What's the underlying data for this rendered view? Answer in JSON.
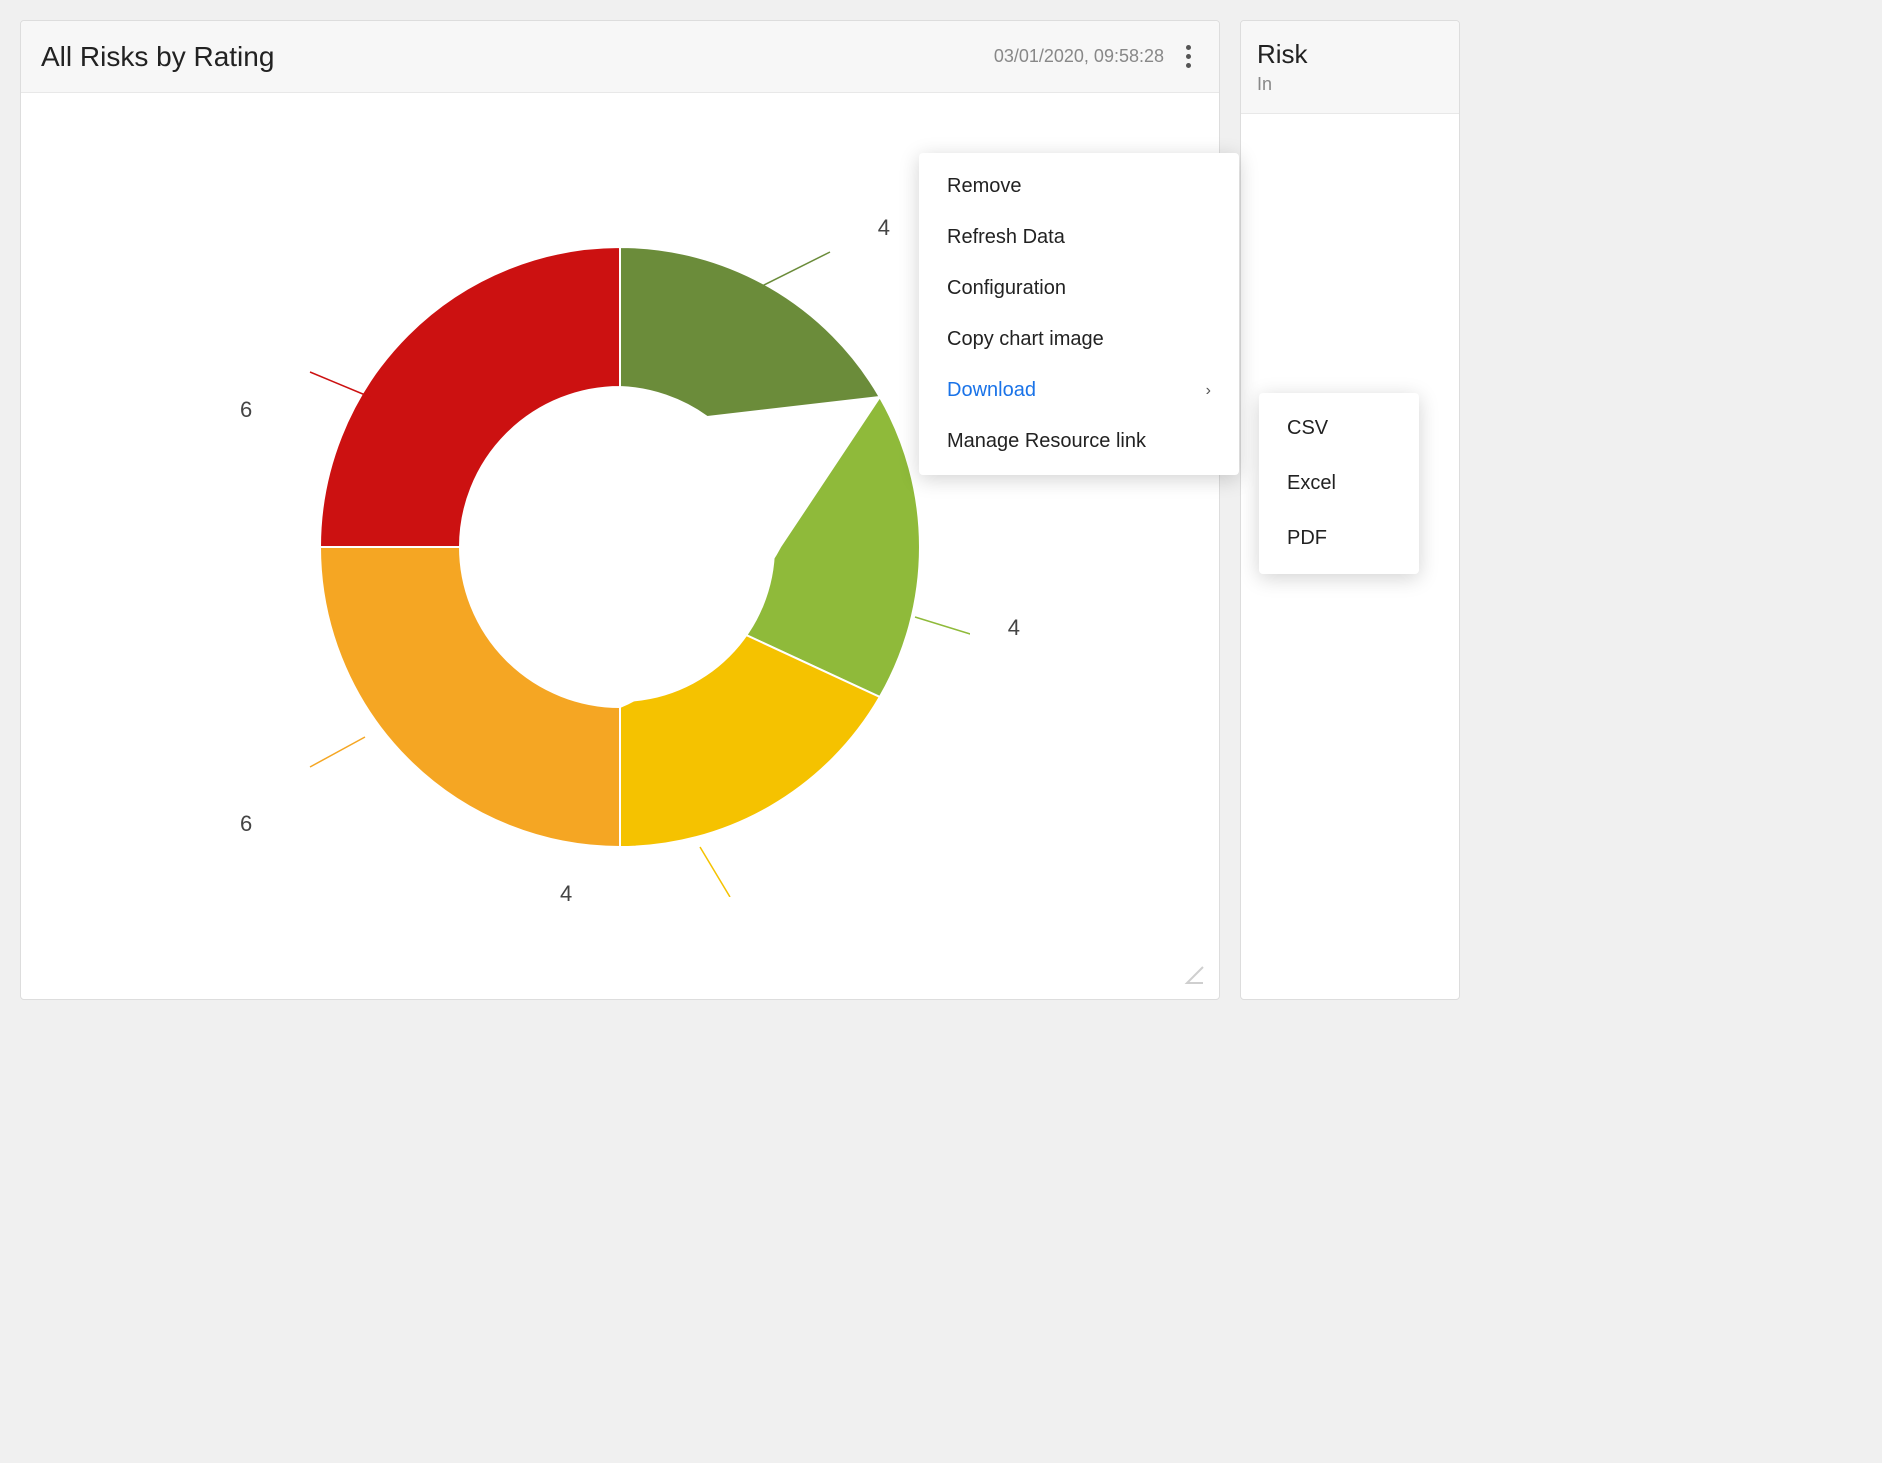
{
  "panel": {
    "title": "All Risks by Rating",
    "timestamp": "03/01/2020, 09:58:28"
  },
  "chart": {
    "labels": {
      "top_right": "4",
      "left_top": "6",
      "right_mid": "4",
      "left_bottom": "6",
      "bottom": "4"
    },
    "segments": [
      {
        "color": "#6b8c3a",
        "label": "Dark Green",
        "value": 4
      },
      {
        "color": "#8fba3a",
        "label": "Light Green",
        "value": 4
      },
      {
        "color": "#f5c200",
        "label": "Yellow",
        "value": 4
      },
      {
        "color": "#f5a623",
        "label": "Orange",
        "value": 6
      },
      {
        "color": "#cc1111",
        "label": "Red",
        "value": 6
      }
    ]
  },
  "context_menu": {
    "items": [
      {
        "id": "remove",
        "label": "Remove",
        "active": false,
        "has_submenu": false
      },
      {
        "id": "refresh",
        "label": "Refresh Data",
        "active": false,
        "has_submenu": false
      },
      {
        "id": "configuration",
        "label": "Configuration",
        "active": false,
        "has_submenu": false
      },
      {
        "id": "copy_chart",
        "label": "Copy chart image",
        "active": false,
        "has_submenu": false
      },
      {
        "id": "download",
        "label": "Download",
        "active": true,
        "has_submenu": true
      },
      {
        "id": "manage",
        "label": "Manage Resource link",
        "active": false,
        "has_submenu": false
      }
    ],
    "submenu": {
      "items": [
        {
          "id": "csv",
          "label": "CSV"
        },
        {
          "id": "excel",
          "label": "Excel"
        },
        {
          "id": "pdf",
          "label": "PDF"
        }
      ]
    }
  },
  "right_panel": {
    "title": "Risk",
    "subtitle": "In"
  },
  "icons": {
    "kebab": "⋮",
    "chevron_right": "›",
    "resize": "↙"
  }
}
